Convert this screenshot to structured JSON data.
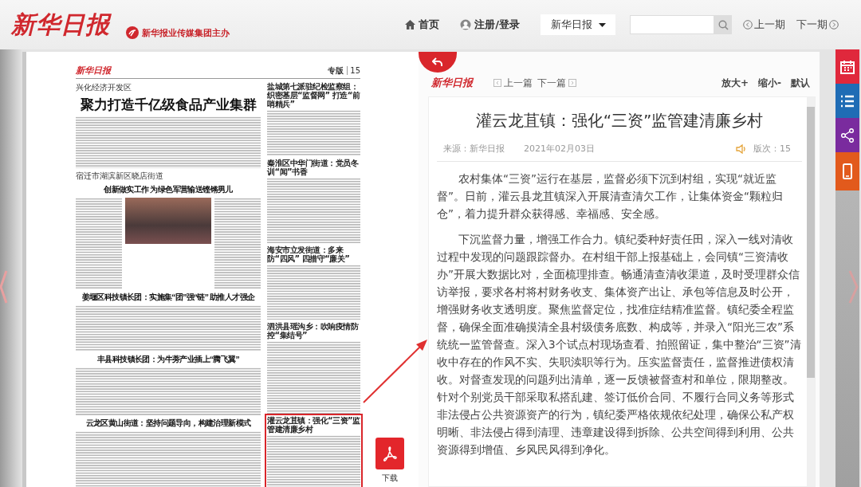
{
  "header": {
    "logo": "新华日报",
    "publisher": "新华报业传媒集团主办",
    "nav": [
      {
        "kind": "home",
        "label": "首页"
      },
      {
        "kind": "user",
        "label": "注册/登录"
      }
    ],
    "edition_select": "新华日报",
    "issue_nav": {
      "prev": "上一期",
      "next": "下一期"
    }
  },
  "newspaper": {
    "masthead": "新华日报",
    "section": "专版",
    "page_no": "15",
    "main_stories": [
      {
        "kicker": "兴化经济开发区",
        "headline": "聚力打造千亿级食品产业集群",
        "kind": "lead"
      },
      {
        "kicker": "宿迁市湖滨新区晓店街道",
        "headline": "创新做实工作 为绿色军营输送铿锵男儿",
        "kind": "photo"
      },
      {
        "headline": "姜堰区科技镇长团：实施集“团”强“链” 助推人才强企",
        "kind": "text"
      },
      {
        "headline": "丰县科技镇长团：为牛蒡产业插上“腾飞翼”",
        "kind": "text"
      },
      {
        "headline": "云龙区黄山街道：坚持问题导向，构建治理新模式",
        "kind": "text"
      }
    ],
    "side_stories": [
      {
        "headline": "盐城第七派驻纪检监察组：织密基层“监督网” 打造“前哨精兵”",
        "selected": false
      },
      {
        "headline": "秦淮区中华门街道：党员冬训“闻”书香",
        "selected": false
      },
      {
        "headline": "海安市立发街道：多来防“四风” 四措守“廉关”",
        "selected": false
      },
      {
        "headline": "泗洪县瑶沟乡：吹响疫情防控“集结号”",
        "selected": false
      },
      {
        "headline": "灌云龙苴镇：强化“三资”监管建清廉乡村",
        "selected": true
      }
    ],
    "download": "下载"
  },
  "article": {
    "logo": "新华日报",
    "prev": "上一篇",
    "next": "下一篇",
    "font_controls": [
      "放大+",
      "缩小-",
      "默认"
    ],
    "title": "灌云龙苴镇：强化“三资”监管建清廉乡村",
    "source": "来源：新华日报",
    "date": "2021年02月03日",
    "page": "版次：15",
    "paragraphs": [
      "农村集体“三资”运行在基层，监督必须下沉到村组，实现“就近监督”。日前，灌云县龙苴镇深入开展清查清欠工作，让集体资金“颗粒归仓”，着力提升群众获得感、幸福感、安全感。",
      "下沉监督力量，增强工作合力。镇纪委种好责任田，深入一线对清收过程中发现的问题跟踪督办。在村组干部上报基础上，会同镇“三资清收办”开展大数据比对，全面梳理排查。畅通清查清收渠道，及时受理群众信访举报，要求各村将村财务收支、集体资产出让、承包等信息及时公开，增强财务收支透明度。聚焦监督定位，找准症结精准监督。镇纪委全程监督，确保全面准确摸清全县村级债务底数、构成等，并录入“阳光三农”系统统一监管督查。深入3个试点村现场查看、拍照留证，集中整治“三资”清收中存在的作风不实、失职渎职等行为。压实监督责任，监督推进债权清收。对督查发现的问题列出清单，逐一反馈被督查村和单位，限期整改。针对个别党员干部采取私搭乱建、签订低价合同、不履行合同义务等形式非法侵占公共资源资产的行为，镇纪委严格依规依纪处理，确保公私产权明晰、非法侵占得到清理、违章建设得到拆除、公共空间得到利用、公共资源得到增值、乡风民风得到净化。"
    ]
  },
  "side_tools": [
    {
      "kind": "calendar",
      "color": "#e0283c"
    },
    {
      "kind": "list",
      "color": "#1f6cb5"
    },
    {
      "kind": "share",
      "color": "#7a2b9e"
    },
    {
      "kind": "phone",
      "color": "#e25a1c"
    }
  ]
}
